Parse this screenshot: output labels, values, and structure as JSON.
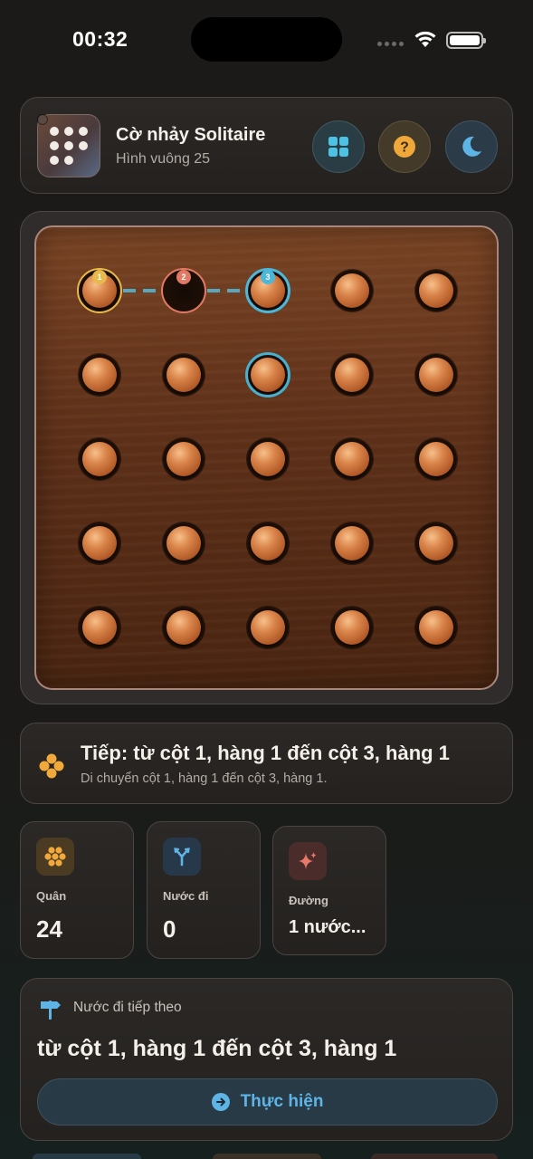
{
  "status_bar": {
    "time": "00:32"
  },
  "header": {
    "title": "Cờ nhảy Solitaire",
    "subtitle": "Hình vuông 25",
    "buttons": [
      "grid-icon",
      "help-icon",
      "moon-icon"
    ]
  },
  "board": {
    "rows": 5,
    "cols": 5,
    "pegs": [
      [
        1,
        0,
        1,
        1,
        1
      ],
      [
        1,
        1,
        1,
        1,
        1
      ],
      [
        1,
        1,
        1,
        1,
        1
      ],
      [
        1,
        1,
        1,
        1,
        1
      ],
      [
        1,
        1,
        1,
        1,
        1
      ]
    ],
    "path_badges": [
      "1",
      "2",
      "3"
    ],
    "selected_cell": "row 2, col 3"
  },
  "hint": {
    "title": "Tiếp: từ cột 1, hàng 1 đến cột 3, hàng 1",
    "subtitle": "Di chuyển cột 1, hàng 1 đến cột 3, hàng 1."
  },
  "stats": [
    {
      "label": "Quân",
      "value": "24",
      "icon": "pegs-icon",
      "color": "#f2a93b"
    },
    {
      "label": "Nước đi",
      "value": "0",
      "icon": "branch-icon",
      "color": "#5fb4e6"
    },
    {
      "label": "Đường",
      "value": "1 nước...",
      "icon": "sparkle-icon",
      "color": "#e8786a"
    }
  ],
  "next_move": {
    "label": "Nước đi tiếp theo",
    "move": "từ cột 1, hàng 1 đến cột 3, hàng 1",
    "button": "Thực hiện"
  },
  "colors": {
    "accent": "#5fb4e6",
    "gold": "#e8b94b",
    "coral": "#e07a64",
    "wood": "#6a3a1e"
  }
}
